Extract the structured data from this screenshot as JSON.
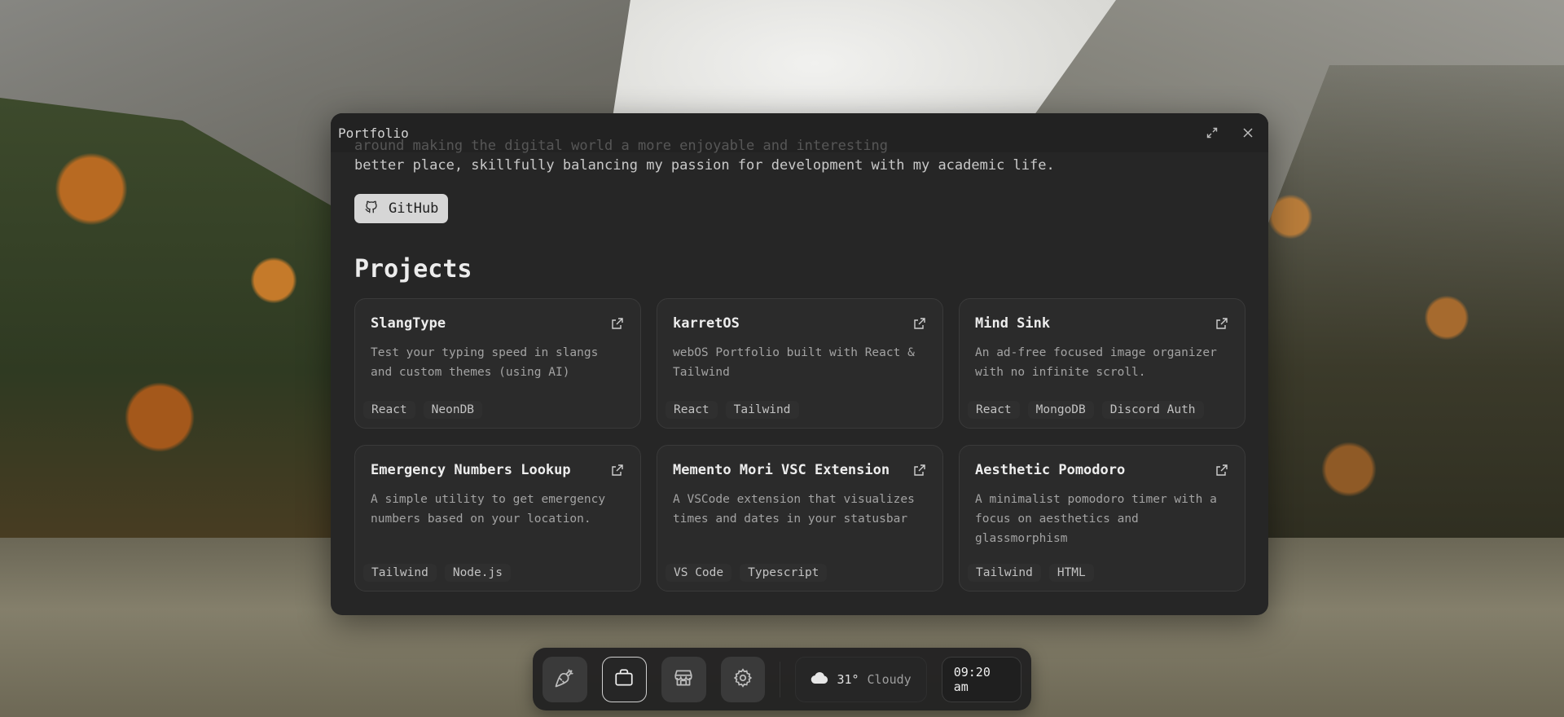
{
  "window": {
    "title": "Portfolio",
    "maximize_icon": "maximize-icon",
    "close_icon": "close-icon"
  },
  "intro": {
    "line_partial": "around making the digital world a more enjoyable and interesting",
    "line": "better place, skillfully balancing my passion for development with my academic life."
  },
  "github": {
    "label": "GitHub",
    "icon": "github-icon"
  },
  "projects_heading": "Projects",
  "projects": [
    {
      "title": "SlangType",
      "description": "Test your typing speed in slangs and custom themes (using AI)",
      "tags": [
        "React",
        "NeonDB"
      ]
    },
    {
      "title": "karretOS",
      "description": "webOS Portfolio built with React & Tailwind",
      "tags": [
        "React",
        "Tailwind"
      ]
    },
    {
      "title": "Mind Sink",
      "description": "An ad-free focused image organizer with no infinite scroll.",
      "tags": [
        "React",
        "MongoDB",
        "Discord Auth"
      ]
    },
    {
      "title": "Emergency Numbers Lookup",
      "description": "A simple utility to get emergency numbers based on your location.",
      "tags": [
        "Tailwind",
        "Node.js"
      ]
    },
    {
      "title": "Memento Mori VSC Extension",
      "description": "A VSCode extension that visualizes times and dates in your statusbar",
      "tags": [
        "VS Code",
        "Typescript"
      ]
    },
    {
      "title": "Aesthetic Pomodoro",
      "description": "A minimalist pomodoro timer with a focus on aesthetics and glassmorphism",
      "tags": [
        "Tailwind",
        "HTML"
      ]
    }
  ],
  "dock": {
    "apps": [
      {
        "name": "launcher",
        "icon": "carrot-icon",
        "active": false
      },
      {
        "name": "portfolio",
        "icon": "briefcase-icon",
        "active": true
      },
      {
        "name": "store",
        "icon": "store-icon",
        "active": false
      },
      {
        "name": "settings",
        "icon": "gear-icon",
        "active": false
      }
    ],
    "weather": {
      "temp": "31°",
      "condition": "Cloudy",
      "icon": "cloud-icon"
    },
    "clock": "09:20 am"
  },
  "colors": {
    "window_bg": "#262626",
    "card_bg": "#2b2b2b",
    "github_bg": "#d6d6d6"
  }
}
